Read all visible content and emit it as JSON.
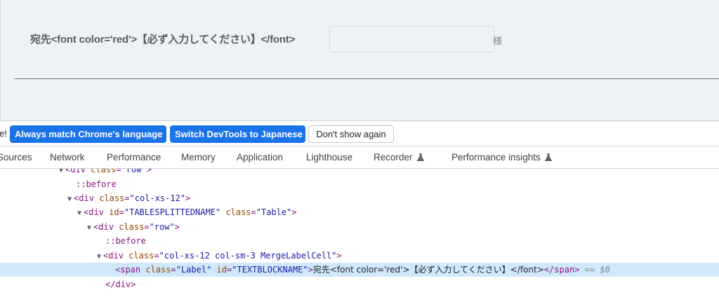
{
  "page": {
    "label": "宛先<font color='red'>【必ず入力してください】</font>",
    "input_value": "",
    "suffix": "様"
  },
  "infobar": {
    "tail_text": "e!",
    "match_button": "Always match Chrome's language",
    "switch_button": "Switch DevTools to Japanese",
    "dismiss_button": "Don't show again"
  },
  "tabs": [
    {
      "label": "Sources"
    },
    {
      "label": "Network"
    },
    {
      "label": "Performance"
    },
    {
      "label": "Memory"
    },
    {
      "label": "Application"
    },
    {
      "label": "Lighthouse"
    },
    {
      "label": "Recorder"
    },
    {
      "label": "Performance insights"
    }
  ],
  "tree": {
    "r0": {
      "tag": "div",
      "attr": "class",
      "val": "\"row\""
    },
    "r1": {
      "pseudo": "::before"
    },
    "r2": {
      "tag": "div",
      "attr": "class",
      "val": "\"col-xs-12\""
    },
    "r3": {
      "tag": "div",
      "attr1": "id",
      "val1": "\"TABLESPLITTEDNAME\"",
      "attr2": "class",
      "val2": "\"Table\""
    },
    "r4": {
      "tag": "div",
      "attr": "class",
      "val": "\"row\""
    },
    "r5": {
      "pseudo": "::before"
    },
    "r6": {
      "tag": "div",
      "attr": "class",
      "val": "\"col-xs-12 col-sm-3 MergeLabelCell\""
    },
    "r7": {
      "tag": "span",
      "attr1": "class",
      "val1": "\"Label\"",
      "attr2": "id",
      "val2": "\"TEXTBLOCKNAME\"",
      "text": "宛先<font color='red'>【必ず入力してください】</font>",
      "dollar": "== $0"
    },
    "r8": {
      "close": "</div>"
    }
  },
  "colors": {
    "page_bg": "#eef2f5",
    "primary_button": "#1a73e8",
    "selected_row": "#cfe8fc",
    "tag": "#881280",
    "attribute": "#994500",
    "value": "#1a1aa6"
  }
}
